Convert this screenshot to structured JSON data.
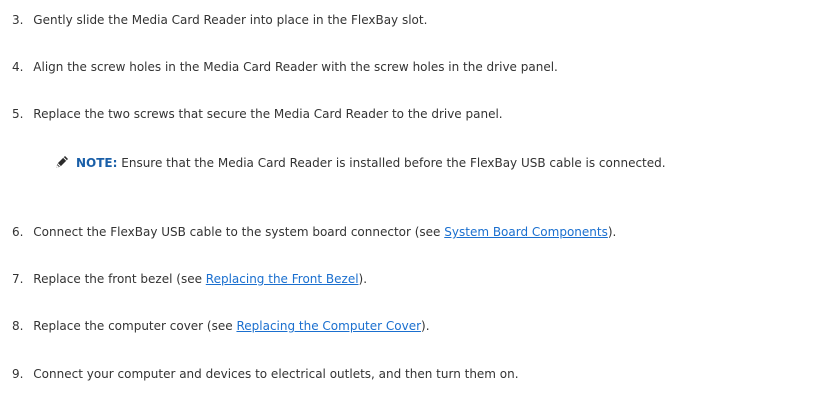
{
  "steps": [
    {
      "num": "3.",
      "text": "Gently slide the Media Card Reader into place in the FlexBay slot."
    },
    {
      "num": "4.",
      "text": "Align the screw holes in the Media Card Reader with the screw holes in the drive panel."
    },
    {
      "num": "5.",
      "text": "Replace the two screws that secure the Media Card Reader to the drive panel."
    },
    {
      "num": "6.",
      "text_before": "Connect the FlexBay USB cable to the system board connector (see ",
      "link": "System Board Components",
      "text_after": ")."
    },
    {
      "num": "7.",
      "text_before": "Replace the front bezel (see ",
      "link": "Replacing the Front Bezel",
      "text_after": ")."
    },
    {
      "num": "8.",
      "text_before": "Replace the computer cover (see ",
      "link": "Replacing the Computer Cover",
      "text_after": ")."
    },
    {
      "num": "9.",
      "text": "Connect your computer and devices to electrical outlets, and then turn them on."
    }
  ],
  "note": {
    "icon": "pencil-note-icon",
    "label": "NOTE:",
    "text": " Ensure that the Media Card Reader is installed before the FlexBay USB cable is connected."
  },
  "colors": {
    "link": "#1a6fcf",
    "note_label": "#1a5fa8",
    "text": "#333333"
  }
}
